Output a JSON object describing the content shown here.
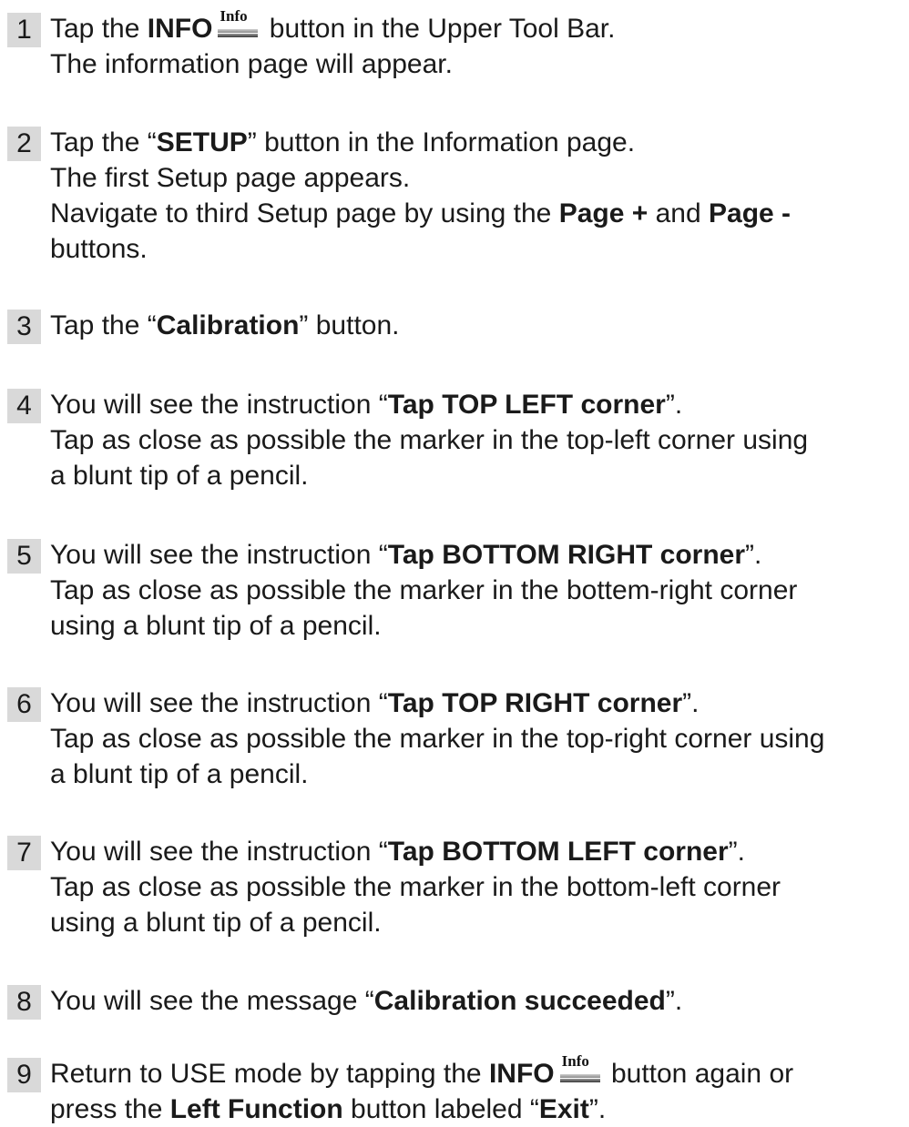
{
  "steps": [
    {
      "number": "1",
      "lines": [
        {
          "a": "Tap the ",
          "b": "INFO",
          "c": " button in the Upper Tool Bar."
        },
        {
          "a": "The information page will appear."
        }
      ]
    },
    {
      "number": "2",
      "lines": [
        {
          "a": "Tap the “",
          "b": "SETUP",
          "c": "” button in the Information page."
        },
        {
          "a": "The first Setup page appears."
        },
        {
          "a": "Navigate to third Setup page by using the ",
          "b": "Page +",
          "c": " and ",
          "d": "Page -"
        },
        {
          "a": "buttons."
        }
      ]
    },
    {
      "number": "3",
      "lines": [
        {
          "a": "Tap the “",
          "b": "Calibration",
          "c": "” button."
        }
      ]
    },
    {
      "number": "4",
      "lines": [
        {
          "a": "You will see the instruction “",
          "b": "Tap TOP LEFT corner",
          "c": "”."
        },
        {
          "a": "Tap as close as possible the marker in the top-left corner using"
        },
        {
          "a": "a blunt tip of a pencil."
        }
      ]
    },
    {
      "number": "5",
      "lines": [
        {
          "a": "You will see the instruction “",
          "b": "Tap BOTTOM RIGHT corner",
          "c": "”."
        },
        {
          "a": "Tap as close as possible the marker in the bottem-right corner"
        },
        {
          "a": "using a blunt tip of a pencil."
        }
      ]
    },
    {
      "number": "6",
      "lines": [
        {
          "a": "You will see the instruction “",
          "b": "Tap TOP RIGHT corner",
          "c": "”."
        },
        {
          "a": "Tap as close as possible the marker in the top-right corner using"
        },
        {
          "a": "a blunt tip of a pencil."
        }
      ]
    },
    {
      "number": "7",
      "lines": [
        {
          "a": "You will see the instruction “",
          "b": "Tap BOTTOM LEFT corner",
          "c": "”."
        },
        {
          "a": "Tap as close as possible the marker in the bottom-left corner"
        },
        {
          "a": "using a blunt tip of a pencil."
        }
      ]
    },
    {
      "number": "8",
      "lines": [
        {
          "a": "You will see the message “",
          "b": "Calibration succeeded",
          "c": "”."
        }
      ]
    },
    {
      "number": "9",
      "lines": [
        {
          "a": "Return to USE mode by tapping the ",
          "b": "INFO",
          "c": " button again or"
        },
        {
          "a": "press the ",
          "b": "Left Function",
          "c": " button labeled “",
          "d": "Exit",
          "e": "”."
        }
      ]
    }
  ],
  "info_icon": {
    "label": "Info",
    "icon": "info-button-icon"
  }
}
